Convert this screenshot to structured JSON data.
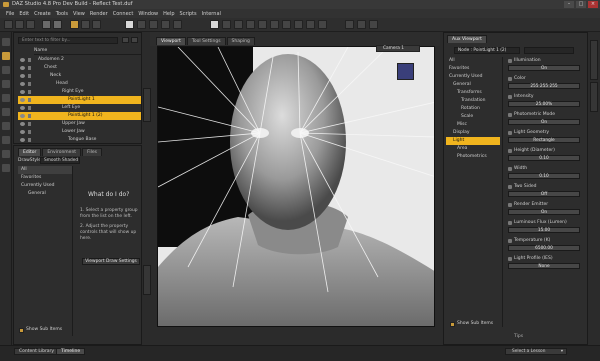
{
  "app": {
    "title": "DAZ Studio 4.8 Pro Dev Build - Reflect Test.duf"
  },
  "menu": [
    "File",
    "Edit",
    "Create",
    "Tools",
    "View",
    "Render",
    "Connect",
    "Window",
    "Help",
    "Scripts",
    "Internal"
  ],
  "scene": {
    "search_placeholder": "Enter text to filter by...",
    "column_name": "Name",
    "nodes": [
      {
        "label": "Abdomen 2",
        "indent": 0,
        "selected": false
      },
      {
        "label": "Chest",
        "indent": 1,
        "selected": false
      },
      {
        "label": "Neck",
        "indent": 2,
        "selected": false
      },
      {
        "label": "Head",
        "indent": 3,
        "selected": false
      },
      {
        "label": "Right Eye",
        "indent": 4,
        "selected": false
      },
      {
        "label": "PointLight 1",
        "indent": 5,
        "selected": true
      },
      {
        "label": "Left Eye",
        "indent": 4,
        "selected": false
      },
      {
        "label": "PointLight 1 (2)",
        "indent": 5,
        "selected": true
      },
      {
        "label": "Upper Jaw",
        "indent": 4,
        "selected": false
      },
      {
        "label": "Lower Jaw",
        "indent": 4,
        "selected": false
      },
      {
        "label": "Tongue Base",
        "indent": 5,
        "selected": false
      }
    ]
  },
  "editor": {
    "tabs": [
      "Editor",
      "Environment",
      "Files"
    ],
    "draw_style_label": "DrawStyle",
    "draw_style_value": "Smooth Shaded",
    "list": [
      "All",
      "Favorites",
      "Currently Used",
      "General"
    ],
    "help_title": "What do I do?",
    "help_steps": [
      "1. Select a property group from the list on the left.",
      "2. Adjust the property controls that will show up here."
    ],
    "button": "Viewport Draw Settings",
    "show_sub_items": "Show Sub Items"
  },
  "viewport": {
    "tabs": [
      "Viewport",
      "Tool Settings",
      "Shaping"
    ],
    "camera": "Camera 1"
  },
  "parameters": {
    "tabs": [
      "Aux Viewport"
    ],
    "node_selector": "Node : PointLight 1 (2)",
    "tree": [
      "All",
      "Favorites",
      "Currently Used",
      "General",
      "Transforms",
      "Translation",
      "Rotation",
      "Scale",
      "Misc",
      "Display",
      "Light",
      "Area",
      "Photometrics"
    ],
    "selected_group": "Light",
    "props": [
      {
        "name": "Illumination",
        "value": "On"
      },
      {
        "name": "Color",
        "value": "255     255     255"
      },
      {
        "name": "Intensity",
        "value": "25.00%"
      },
      {
        "name": "Photometric Mode",
        "value": "On"
      },
      {
        "name": "Light Geometry",
        "value": "Rectangle"
      },
      {
        "name": "Height (Diameter)",
        "value": "0.10"
      },
      {
        "name": "Width",
        "value": "0.10"
      },
      {
        "name": "Two Sided",
        "value": "Off"
      },
      {
        "name": "Render Emitter",
        "value": "On"
      },
      {
        "name": "Luminous Flux (Lumen)",
        "value": "15.00"
      },
      {
        "name": "Temperature (K)",
        "value": "6500.00"
      },
      {
        "name": "Light Profile (IES)",
        "value": "None"
      }
    ],
    "show_sub_items": "Show Sub Items",
    "tips": "Tips"
  },
  "bottom": {
    "tabs": [
      "Content Library",
      "Timeline"
    ],
    "lesson": "Select a Lesson",
    "lesson_icon": "chevron-down-icon"
  },
  "colors": {
    "accent": "#f0b41e",
    "background": "#2b2b2b",
    "viewport_bg": "#e9e9e9"
  }
}
